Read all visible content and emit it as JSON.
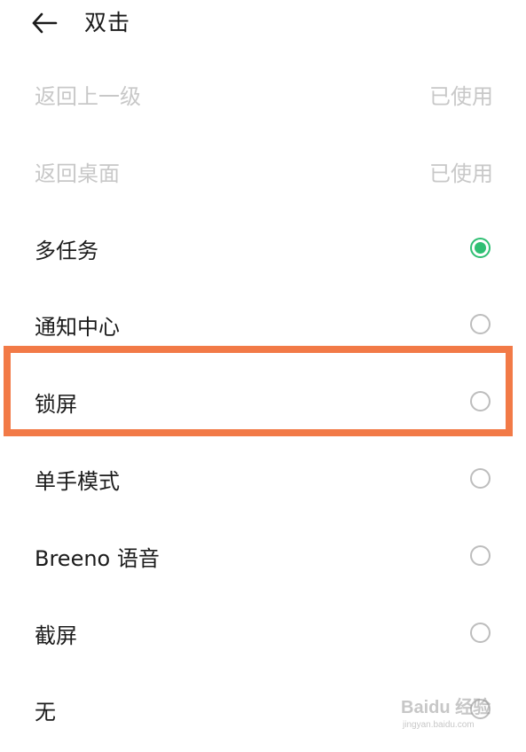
{
  "header": {
    "title": "双击",
    "back_icon": "arrow-left-icon"
  },
  "options": [
    {
      "label": "返回上一级",
      "status": "已使用",
      "disabled": true,
      "selected": false
    },
    {
      "label": "返回桌面",
      "status": "已使用",
      "disabled": true,
      "selected": false
    },
    {
      "label": "多任务",
      "status": "",
      "disabled": false,
      "selected": true
    },
    {
      "label": "通知中心",
      "status": "",
      "disabled": false,
      "selected": false
    },
    {
      "label": "锁屏",
      "status": "",
      "disabled": false,
      "selected": false
    },
    {
      "label": "单手模式",
      "status": "",
      "disabled": false,
      "selected": false
    },
    {
      "label": "Breeno 语音",
      "status": "",
      "disabled": false,
      "selected": false
    },
    {
      "label": "截屏",
      "status": "",
      "disabled": false,
      "selected": false
    },
    {
      "label": "无",
      "status": "",
      "disabled": false,
      "selected": false
    }
  ],
  "colors": {
    "accent": "#2fbf73",
    "highlight": "#f27a47",
    "disabled_text": "#c8c8c8",
    "text": "#1b1b1b"
  },
  "watermark": {
    "logo": "Baidu 经验",
    "url": "jingyan.baidu.com"
  }
}
